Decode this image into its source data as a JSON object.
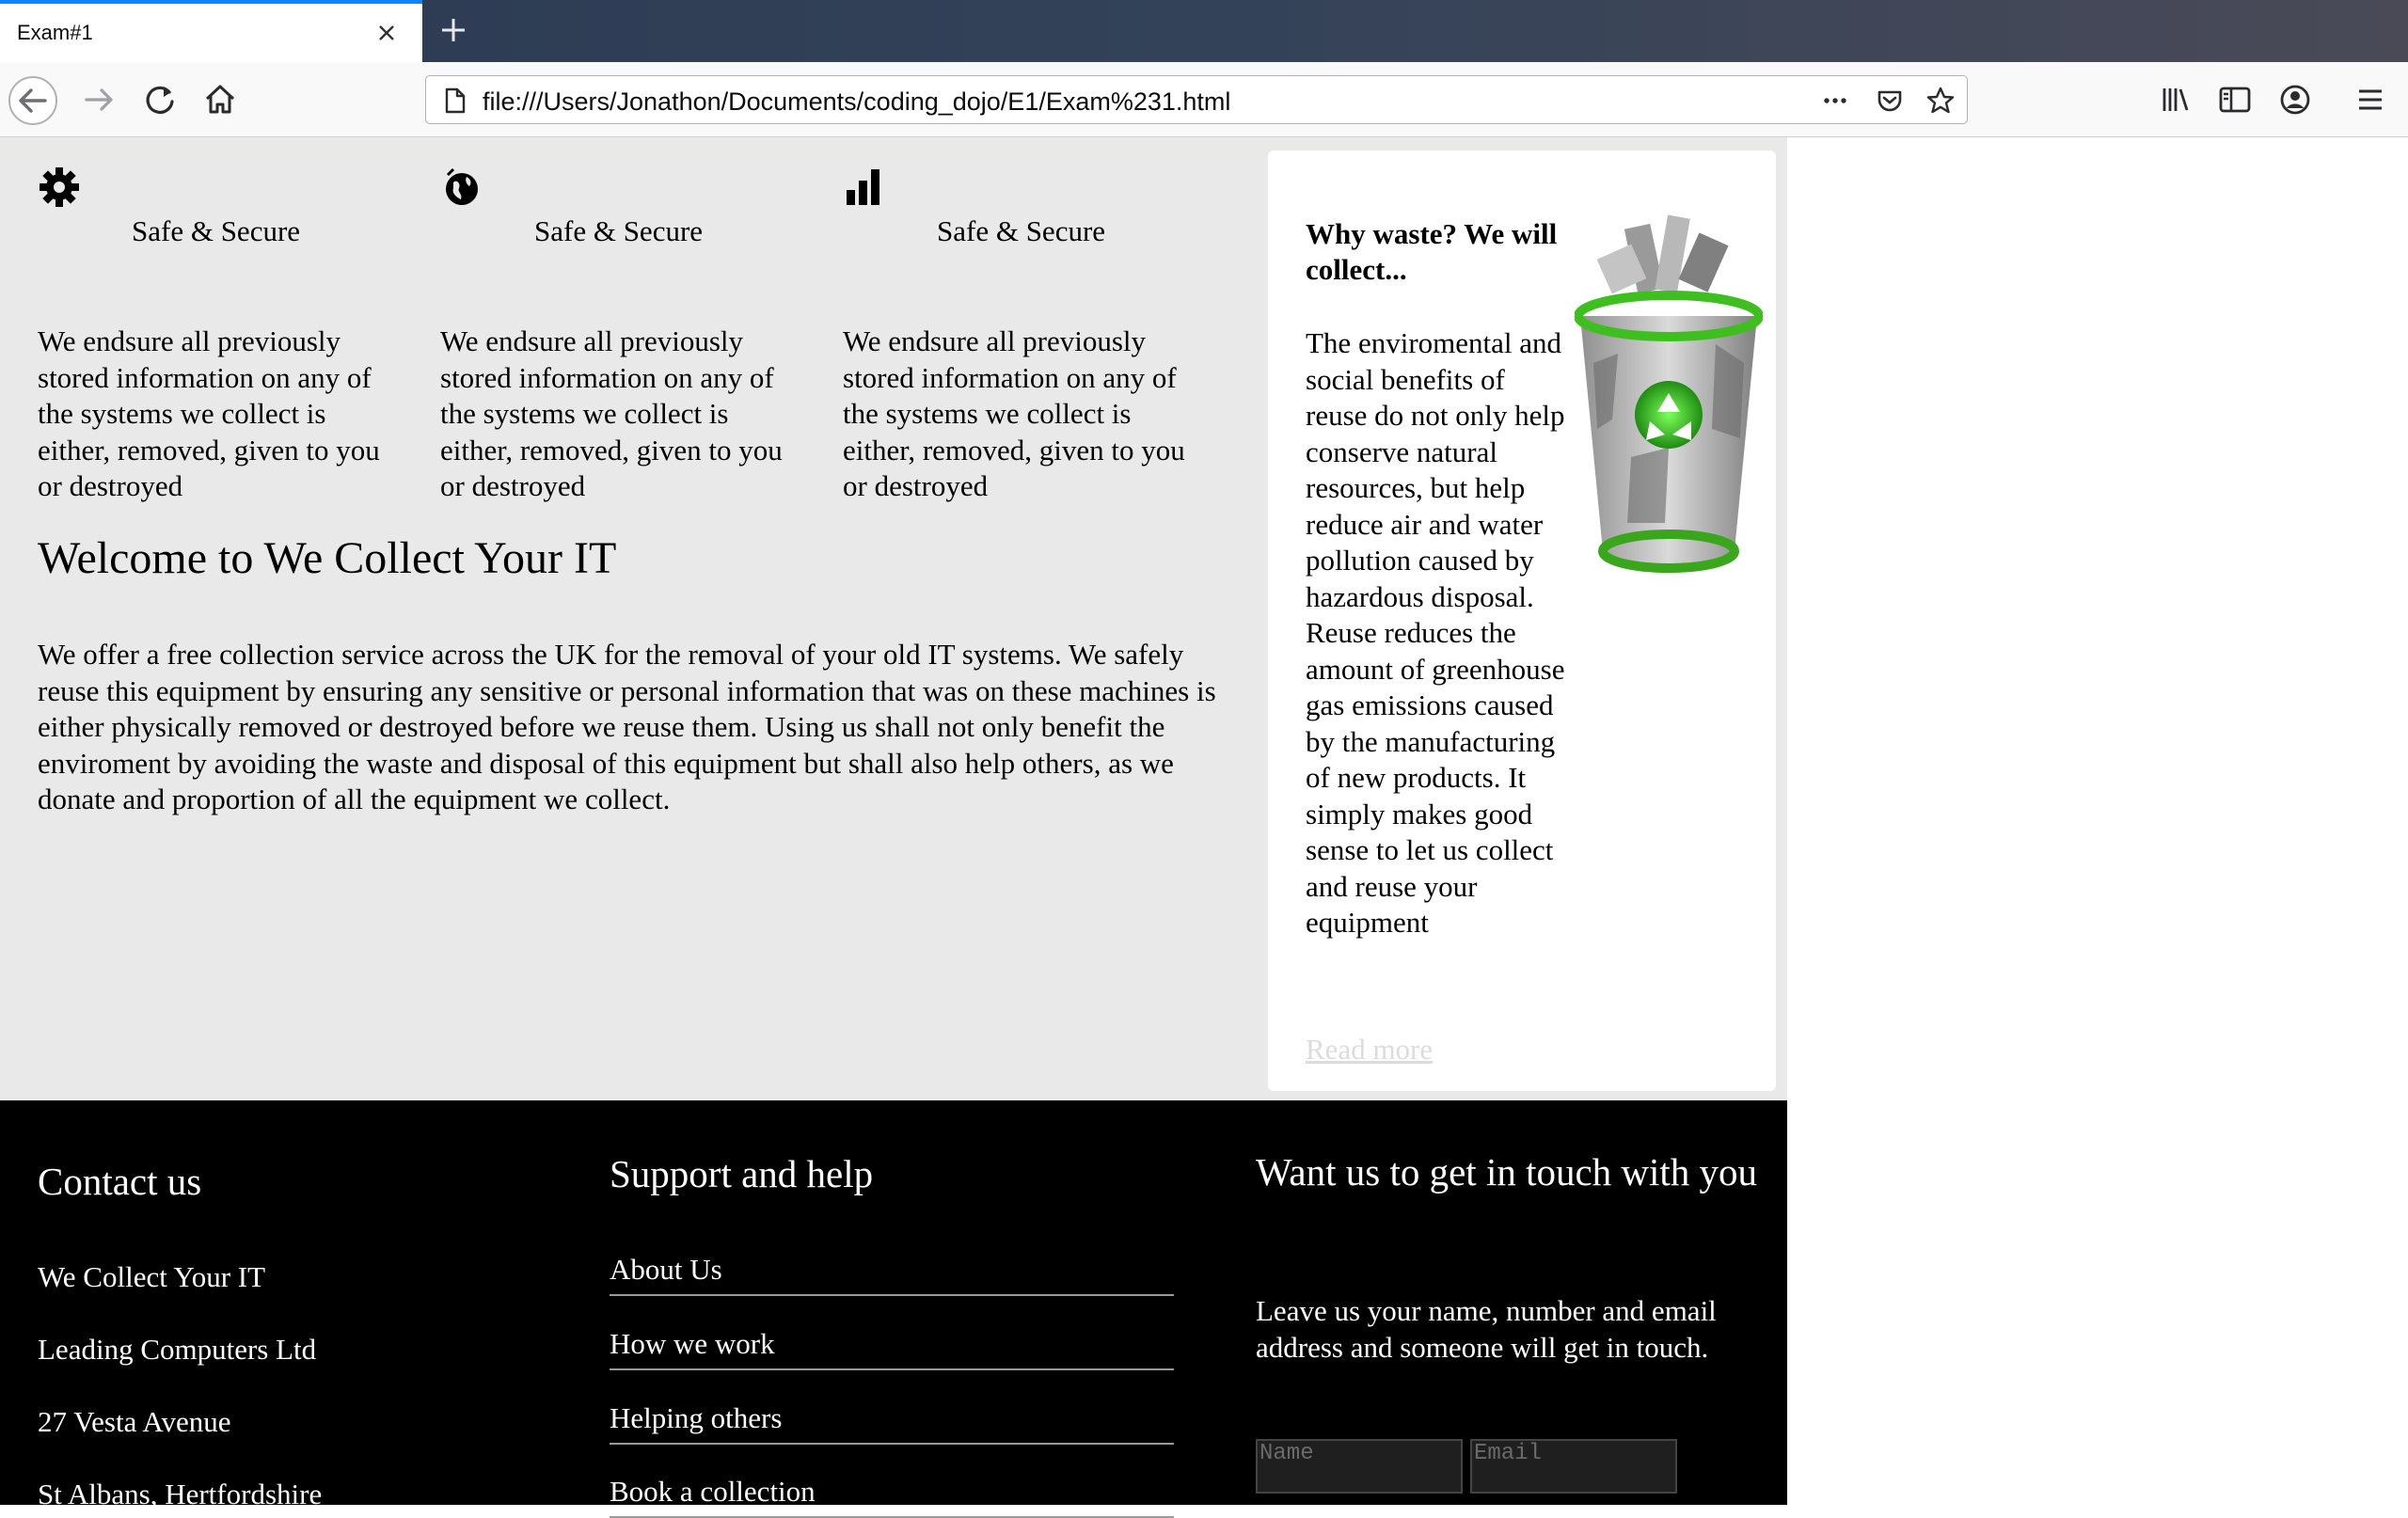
{
  "browser": {
    "tab_title": "Exam#1",
    "url": "file:///Users/Jonathon/Documents/coding_dojo/E1/Exam%231.html"
  },
  "features": [
    {
      "icon": "gear-icon",
      "title": "Safe & Secure",
      "text": "We endsure all previously stored information on any of the systems we collect is either, removed, given to you or destroyed"
    },
    {
      "icon": "globe-icon",
      "title": "Safe & Secure",
      "text": "We endsure all previously stored information on any of the systems we collect is either, removed, given to you or destroyed"
    },
    {
      "icon": "bar-chart-icon",
      "title": "Safe & Secure",
      "text": "We endsure all previously stored information on any of the systems we collect is either, removed, given to you or destroyed"
    }
  ],
  "welcome": {
    "title": "Welcome to We Collect Your IT",
    "text": "We offer a free collection service across the UK for the removal of your old IT systems. We safely reuse this equipment by ensuring any sensitive or personal information that was on these machines is either physically removed or destroyed before we reuse them. Using us shall not only benefit the enviroment by avoiding the waste and disposal of this equipment but shall also help others, as we donate and proportion of all the equipment we collect."
  },
  "aside": {
    "title": "Why waste? We will collect...",
    "text": "The enviromental and social benefits of reuse do not only help conserve natural resources, but help reduce air and water pollution caused by hazardous disposal. Reuse reduces the amount of greenhouse gas emissions caused by the manufacturing of new products. It simply makes good sense to let us collect and reuse your equipment",
    "link": "Read more",
    "image": "recycle-bin-image"
  },
  "footer": {
    "contact": {
      "heading": "Contact us",
      "lines": [
        "We Collect Your IT",
        "Leading Computers Ltd",
        "27 Vesta Avenue",
        "St Albans, Hertfordshire"
      ]
    },
    "support": {
      "heading": "Support and help",
      "links": [
        "About Us",
        "How we work",
        "Helping others",
        "Book a collection"
      ]
    },
    "touch": {
      "heading": "Want us to get in touch with you",
      "text": "Leave us your name, number and email address and someone will get in touch.",
      "name_placeholder": "Name",
      "email_placeholder": "Email"
    }
  }
}
